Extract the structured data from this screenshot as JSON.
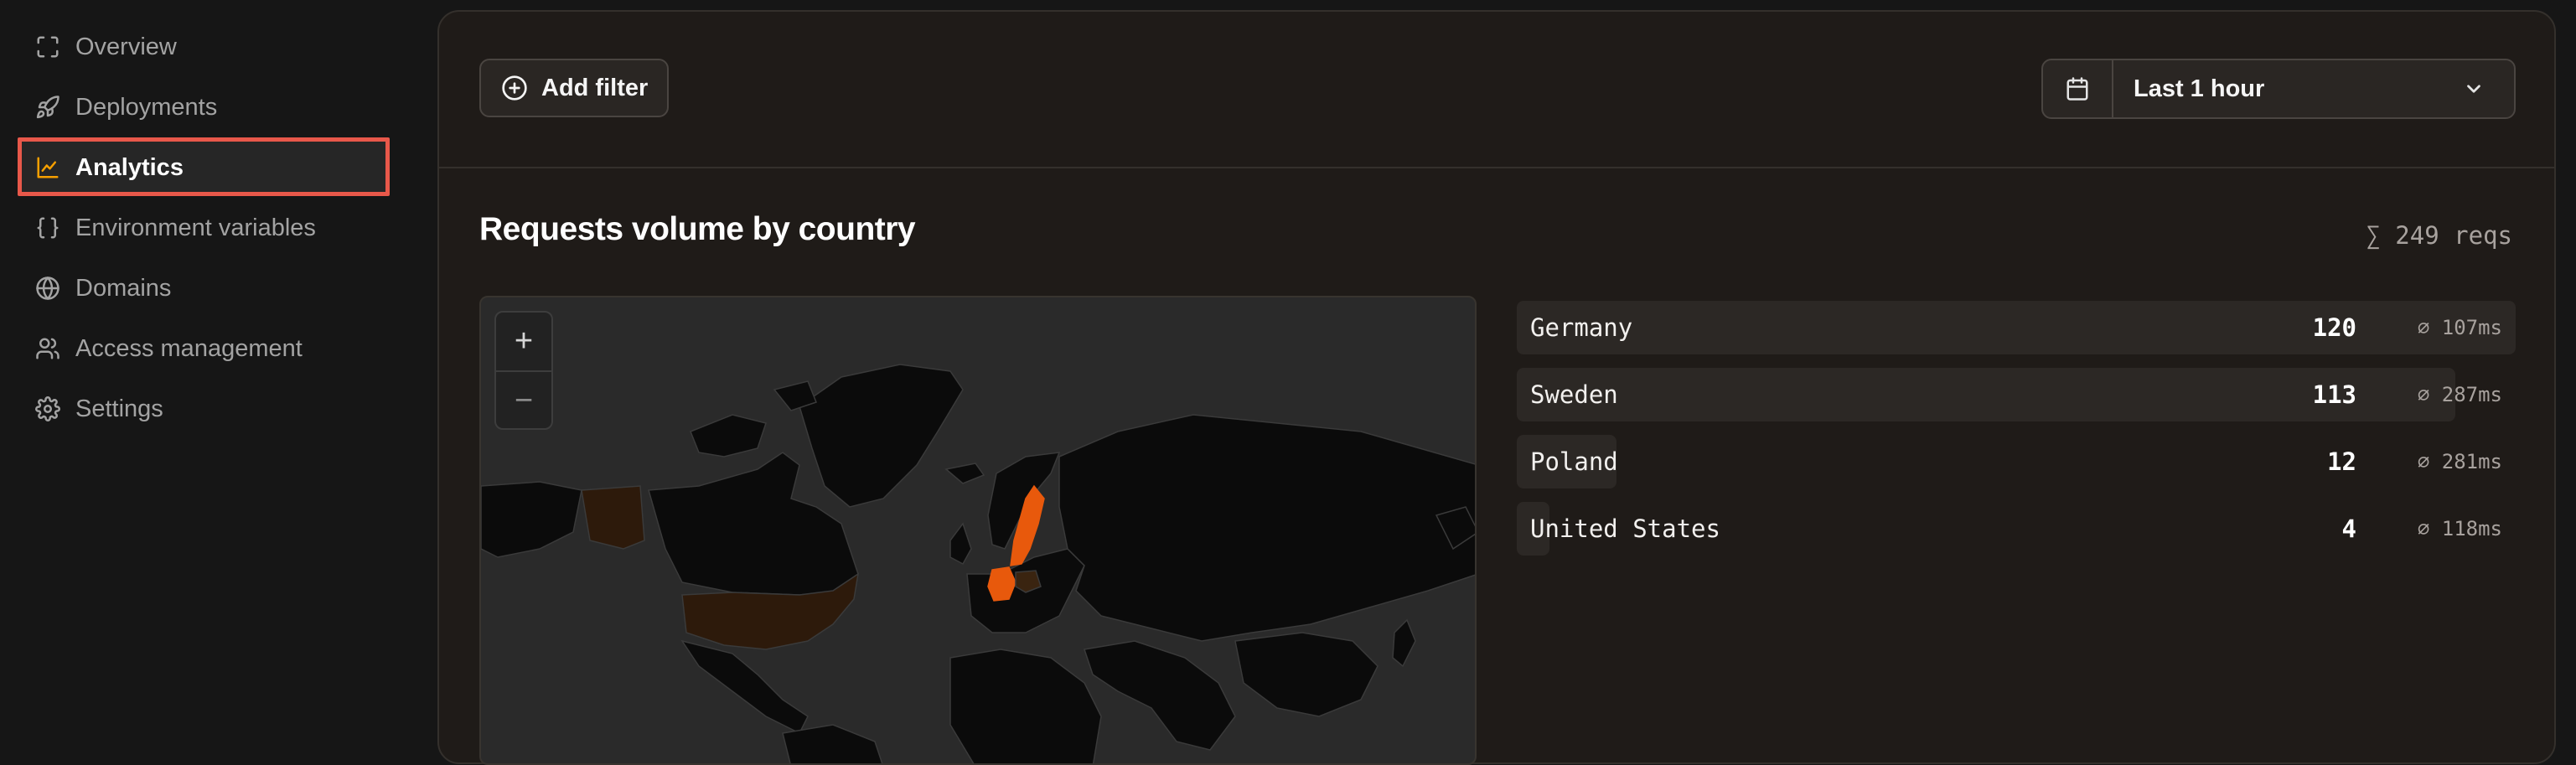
{
  "sidebar": {
    "items": [
      {
        "label": "Overview",
        "icon": "scan-icon",
        "active": false
      },
      {
        "label": "Deployments",
        "icon": "rocket-icon",
        "active": false
      },
      {
        "label": "Analytics",
        "icon": "chart-line-icon",
        "active": true
      },
      {
        "label": "Environment variables",
        "icon": "braces-icon",
        "active": false
      },
      {
        "label": "Domains",
        "icon": "globe-icon",
        "active": false
      },
      {
        "label": "Access management",
        "icon": "users-icon",
        "active": false
      },
      {
        "label": "Settings",
        "icon": "gear-icon",
        "active": false
      }
    ]
  },
  "toolbar": {
    "add_filter_label": "Add filter",
    "time_range": "Last 1 hour"
  },
  "card": {
    "title": "Requests volume by country",
    "total": "∑ 249 reqs"
  },
  "map": {
    "zoom_in": "+",
    "zoom_out": "−"
  },
  "countries": [
    {
      "name": "Germany",
      "count": "120",
      "latency": "⌀ 107ms",
      "fraction": 1.0
    },
    {
      "name": "Sweden",
      "count": "113",
      "latency": "⌀ 287ms",
      "fraction": 0.94
    },
    {
      "name": "Poland",
      "count": "12",
      "latency": "⌀ 281ms",
      "fraction": 0.1
    },
    {
      "name": "United States",
      "count": "4",
      "latency": "⌀ 118ms",
      "fraction": 0.033
    }
  ],
  "colors": {
    "accent": "#e8590c",
    "highlight_outline": "#e8584a",
    "active_icon": "#f59f00"
  }
}
